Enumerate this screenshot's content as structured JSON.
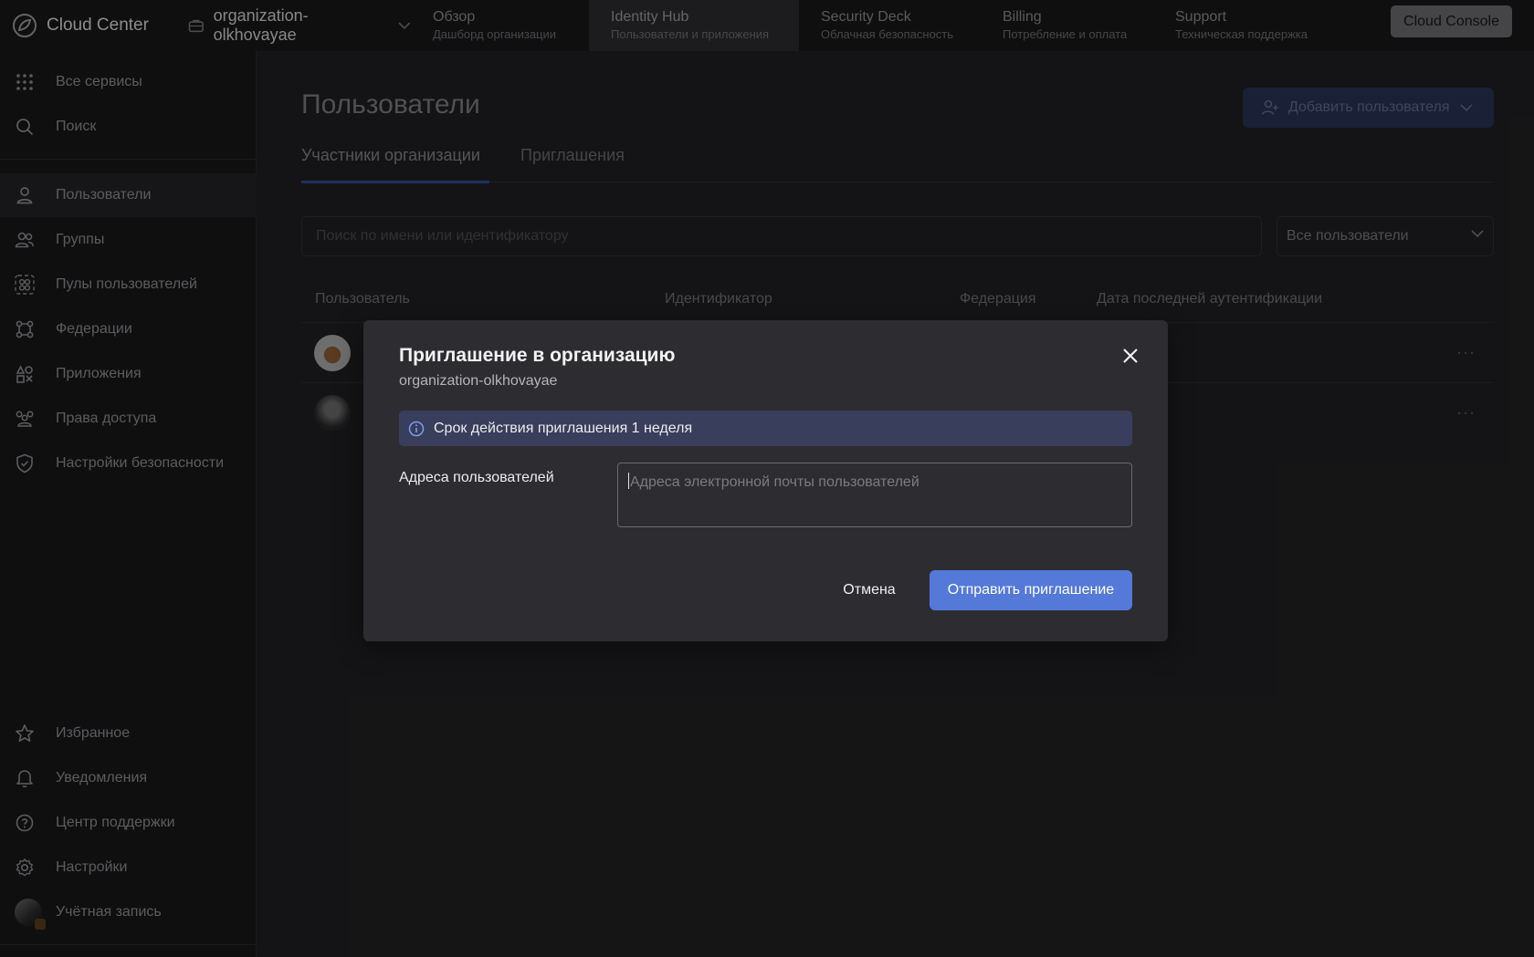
{
  "header": {
    "brand": "Cloud Center",
    "org_name": "organization-olkhovayae",
    "tabs": [
      {
        "title": "Обзор",
        "subtitle": "Дашборд организации"
      },
      {
        "title": "Identity Hub",
        "subtitle": "Пользователи и приложения"
      },
      {
        "title": "Security Deck",
        "subtitle": "Облачная безопасность"
      },
      {
        "title": "Billing",
        "subtitle": "Потребление и оплата"
      },
      {
        "title": "Support",
        "subtitle": "Техническая поддержка"
      }
    ],
    "console_button": "Cloud Console"
  },
  "sidebar": {
    "top_items": [
      {
        "label": "Все сервисы",
        "icon": "grid-icon"
      },
      {
        "label": "Поиск",
        "icon": "search-icon"
      }
    ],
    "items": [
      {
        "label": "Пользователи",
        "icon": "user-icon"
      },
      {
        "label": "Группы",
        "icon": "group-icon"
      },
      {
        "label": "Пулы пользователей",
        "icon": "user-pool-icon"
      },
      {
        "label": "Федерации",
        "icon": "federation-icon"
      },
      {
        "label": "Приложения",
        "icon": "apps-icon"
      },
      {
        "label": "Права доступа",
        "icon": "access-rights-icon"
      },
      {
        "label": "Настройки безопасности",
        "icon": "shield-icon"
      }
    ],
    "bottom_items": [
      {
        "label": "Избранное",
        "icon": "star-icon"
      },
      {
        "label": "Уведомления",
        "icon": "bell-icon"
      },
      {
        "label": "Центр поддержки",
        "icon": "help-icon"
      },
      {
        "label": "Настройки",
        "icon": "gear-icon"
      },
      {
        "label": "Учётная запись",
        "icon": "account-avatar"
      }
    ]
  },
  "main": {
    "title": "Пользователи",
    "add_button": "Добавить пользователя",
    "tabs": [
      "Участники организации",
      "Приглашения"
    ],
    "search_placeholder": "Поиск по имени или идентификатору",
    "filter_value": "Все пользователи",
    "table_headers": [
      "Пользователь",
      "Идентификатор",
      "Федерация",
      "Дата последней аутентификации"
    ],
    "row_actions": "···"
  },
  "modal": {
    "title": "Приглашение в организацию",
    "subtitle": "organization-olkhovayae",
    "info": "Срок действия приглашения 1 неделя",
    "field_label": "Адреса пользователей",
    "field_placeholder": "Адреса электронной почты пользователей",
    "cancel": "Отмена",
    "submit": "Отправить приглашение"
  },
  "colors": {
    "primary": "#5479d9",
    "info_bg": "#393e5c",
    "modal_bg": "#2d2c30",
    "sidebar_bg": "#18181a"
  }
}
